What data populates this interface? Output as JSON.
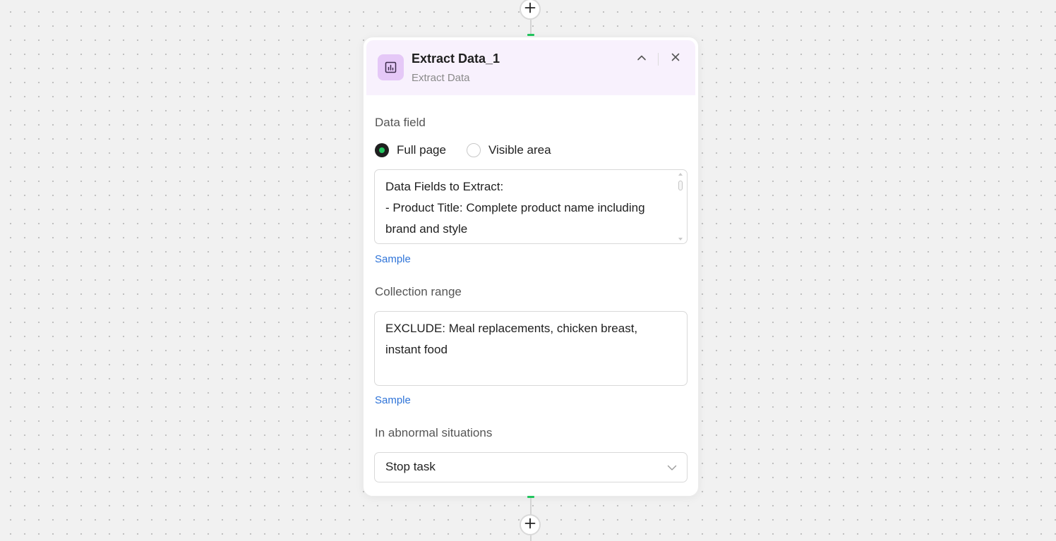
{
  "canvas": {
    "add_step_icon": "plus-icon",
    "port_color": "#22c55e"
  },
  "node": {
    "icon": "chart-icon",
    "icon_bg": "#e5c8f7",
    "header_bg": "#f8f1fd",
    "title": "Extract Data_1",
    "subtitle": "Extract Data",
    "collapse_icon": "chevron-up-icon",
    "close_icon": "close-icon"
  },
  "data_field": {
    "label": "Data field",
    "options": [
      {
        "label": "Full page",
        "checked": true
      },
      {
        "label": "Visible area",
        "checked": false
      }
    ],
    "text": "Data Fields to Extract:\n- Product Title: Complete product name including brand and style\n- Brand Name: Extract separately if available",
    "sample_link": "Sample"
  },
  "collection_range": {
    "label": "Collection range",
    "text": "EXCLUDE: Meal replacements, chicken breast, instant food",
    "sample_link": "Sample"
  },
  "abnormal": {
    "label": "In abnormal situations",
    "value": "Stop task",
    "chevron_icon": "chevron-down-icon"
  },
  "colors": {
    "accent_green": "#22c55e",
    "link_blue": "#2f74d8"
  }
}
